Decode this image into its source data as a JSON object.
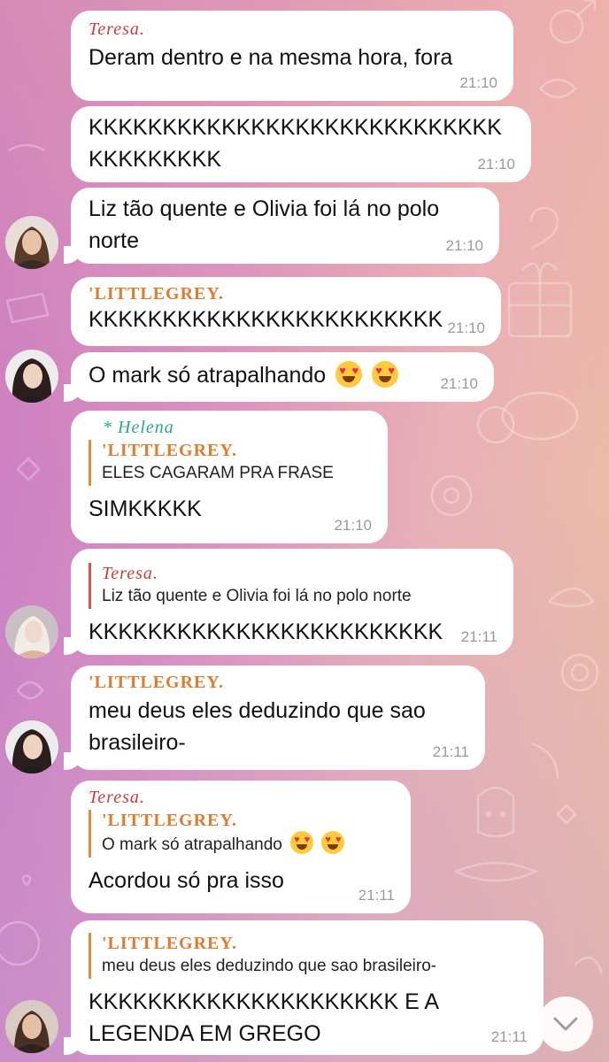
{
  "messages": [
    {
      "sender": "Teresa.",
      "text": "Deram dentro e na mesma hora, fora",
      "time": "21:10"
    },
    {
      "text": "KKKKKKKKKKKKKKKKKKKKKKKKKKKK\nKKKKKKKKK",
      "time": "21:10"
    },
    {
      "text": "Liz tão quente e Olivia foi lá no polo\nnorte",
      "time": "21:10"
    },
    {
      "sender": "'LITTLEGREY.",
      "text": "KKKKKKKKKKKKKKKKKKKKKKKK",
      "time": "21:10"
    },
    {
      "text": "O mark só atrapalhando",
      "time": "21:10",
      "emoji": "heart-eyes-emoji"
    },
    {
      "sender": "* Helena",
      "reply_sender": "'LITTLEGREY.",
      "reply_text": "ELES CAGARAM PRA FRASE",
      "text": "SIMKKKKK",
      "time": "21:10"
    },
    {
      "reply_sender": "Teresa.",
      "reply_text": "Liz tão quente e Olivia foi lá no polo norte",
      "text": "KKKKKKKKKKKKKKKKKKKKKKKK",
      "time": "21:11"
    },
    {
      "sender": "'LITTLEGREY.",
      "text": "meu deus eles deduzindo que sao\nbrasileiro-",
      "time": "21:11"
    },
    {
      "sender": "Teresa.",
      "reply_sender": "'LITTLEGREY.",
      "reply_text": "O mark só atrapalhando",
      "text": "Acordou só pra isso",
      "time": "21:11"
    },
    {
      "reply_sender": "'LITTLEGREY.",
      "reply_text": "meu deus eles deduzindo que sao brasileiro-",
      "text": "KKKKKKKKKKKKKKKKKKKKK E A\nLEGENDA EM GREGO",
      "time": "21:11"
    }
  ],
  "icons": {
    "scroll_down": "chevron-down-icon",
    "avatar": "avatar"
  },
  "colors": {
    "teresa": "#cc3b3b",
    "littlegrey": "#e07b30",
    "helena": "#2da58e"
  }
}
